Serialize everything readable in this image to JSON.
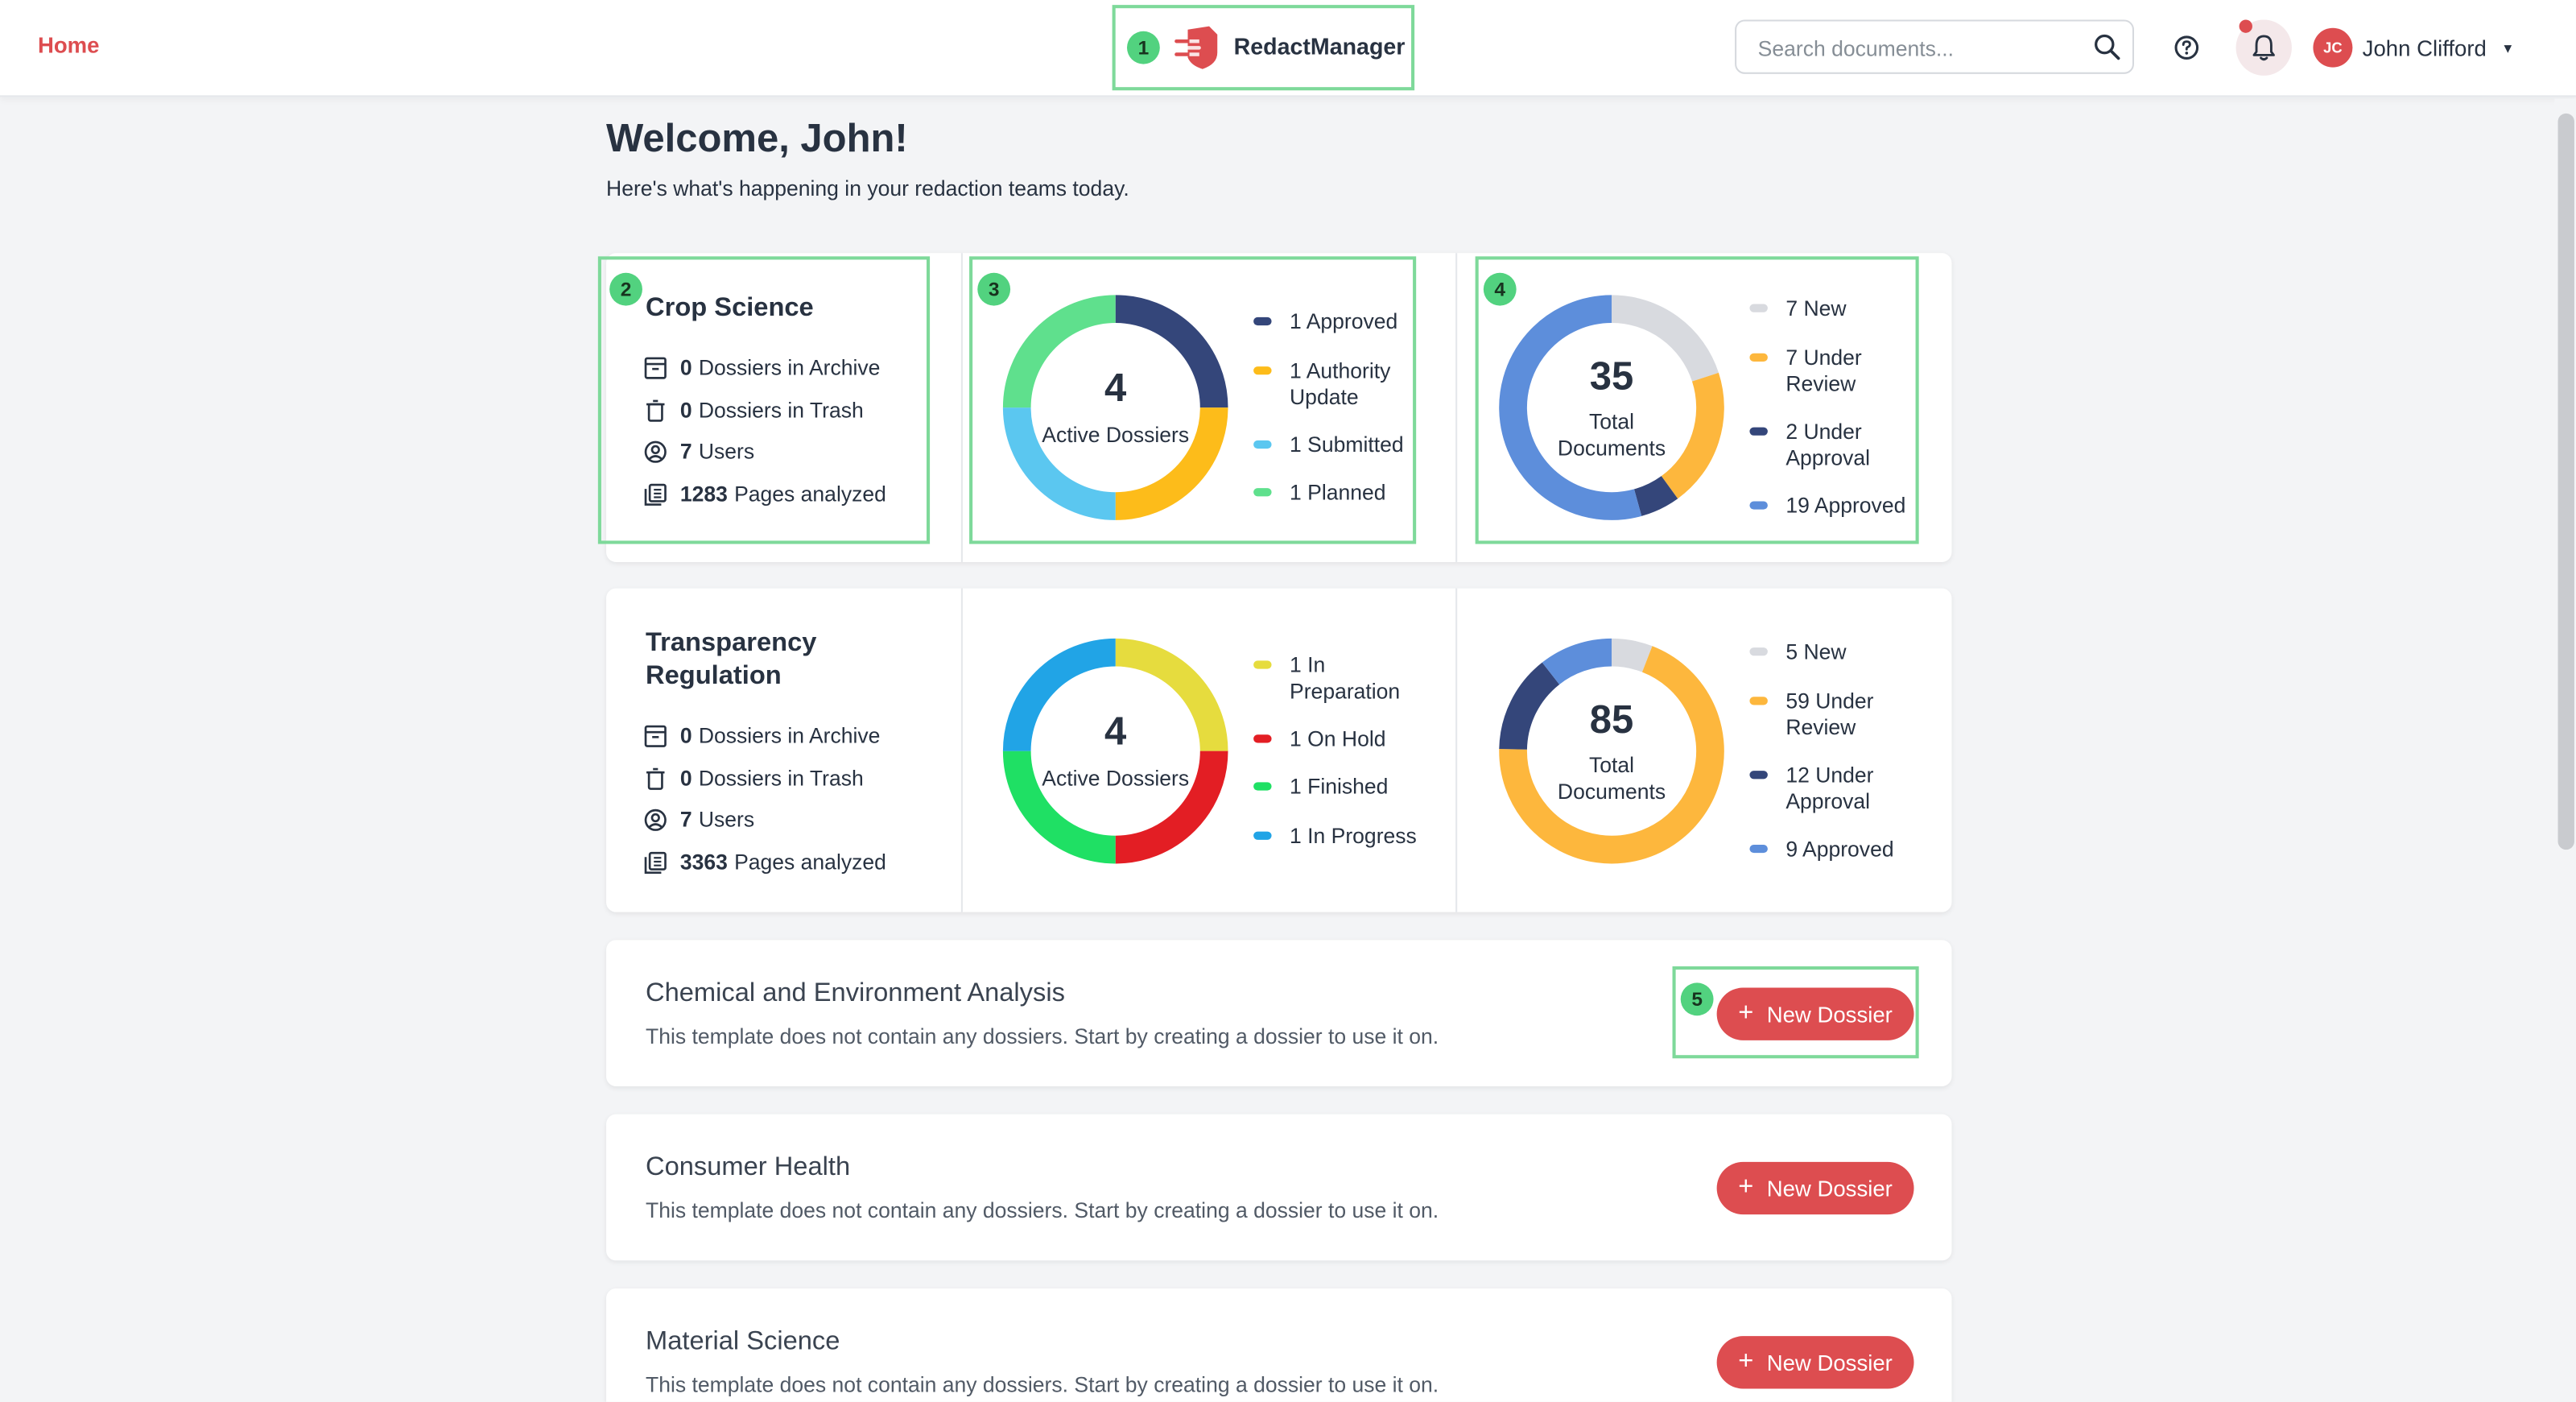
{
  "nav": {
    "home": "Home"
  },
  "brand": {
    "name": "RedactManager"
  },
  "search": {
    "placeholder": "Search documents...",
    "value": ""
  },
  "user": {
    "initials": "JC",
    "name": "John Clifford"
  },
  "welcome": {
    "title": "Welcome, John!",
    "subtitle": "Here's what's happening in your redaction teams today."
  },
  "templates": [
    {
      "name": "Crop Science",
      "archive_count": "0",
      "archive_label": "Dossiers in Archive",
      "trash_count": "0",
      "trash_label": "Dossiers in Trash",
      "users_count": "7",
      "users_label": "Users",
      "pages_count": "1283",
      "pages_label": "Pages analyzed",
      "dossiers": {
        "total": "4",
        "label": "Active Dossiers",
        "legend": [
          {
            "label": "1 Approved",
            "value": 1,
            "color": "#34467a"
          },
          {
            "label": "1 Authority Update",
            "value": 1,
            "color": "#fdbc1a"
          },
          {
            "label": "1 Submitted",
            "value": 1,
            "color": "#5bc7f0"
          },
          {
            "label": "1 Planned",
            "value": 1,
            "color": "#5fe08d"
          }
        ]
      },
      "documents": {
        "total": "35",
        "label": "Total Documents",
        "legend": [
          {
            "label": "7 New",
            "value": 7,
            "color": "#d8dadf"
          },
          {
            "label": "7 Under Review",
            "value": 7,
            "color": "#fdb73d"
          },
          {
            "label": "2 Under Approval",
            "value": 2,
            "color": "#34467a"
          },
          {
            "label": "19 Approved",
            "value": 19,
            "color": "#5d8edb"
          }
        ]
      }
    },
    {
      "name": "Transparency Regulation",
      "archive_count": "0",
      "archive_label": "Dossiers in Archive",
      "trash_count": "0",
      "trash_label": "Dossiers in Trash",
      "users_count": "7",
      "users_label": "Users",
      "pages_count": "3363",
      "pages_label": "Pages analyzed",
      "dossiers": {
        "total": "4",
        "label": "Active Dossiers",
        "legend": [
          {
            "label": "1 In Preparation",
            "value": 1,
            "color": "#e6dc3e"
          },
          {
            "label": "1 On Hold",
            "value": 1,
            "color": "#e31e24"
          },
          {
            "label": "1 Finished",
            "value": 1,
            "color": "#1fe064"
          },
          {
            "label": "1 In Progress",
            "value": 1,
            "color": "#21a4e6"
          }
        ]
      },
      "documents": {
        "total": "85",
        "label": "Total Documents",
        "legend": [
          {
            "label": "5 New",
            "value": 5,
            "color": "#d8dadf"
          },
          {
            "label": "59 Under Review",
            "value": 59,
            "color": "#fdb73d"
          },
          {
            "label": "12 Under Approval",
            "value": 12,
            "color": "#34467a"
          },
          {
            "label": "9 Approved",
            "value": 9,
            "color": "#5d8edb"
          }
        ]
      }
    }
  ],
  "empty_templates": [
    {
      "name": "Chemical and Environment Analysis",
      "description": "This template does not contain any dossiers. Start by creating a dossier to use it on.",
      "button": "New Dossier"
    },
    {
      "name": "Consumer Health",
      "description": "This template does not contain any dossiers. Start by creating a dossier to use it on.",
      "button": "New Dossier"
    },
    {
      "name": "Material Science",
      "description": "This template does not contain any dossiers. Start by creating a dossier to use it on.",
      "button": "New Dossier"
    }
  ],
  "annotations": [
    "1",
    "2",
    "3",
    "4",
    "5"
  ],
  "colors": {
    "accent": "#dd4d50",
    "background": "#f3f4f6",
    "annotation": "#7ed99a"
  }
}
